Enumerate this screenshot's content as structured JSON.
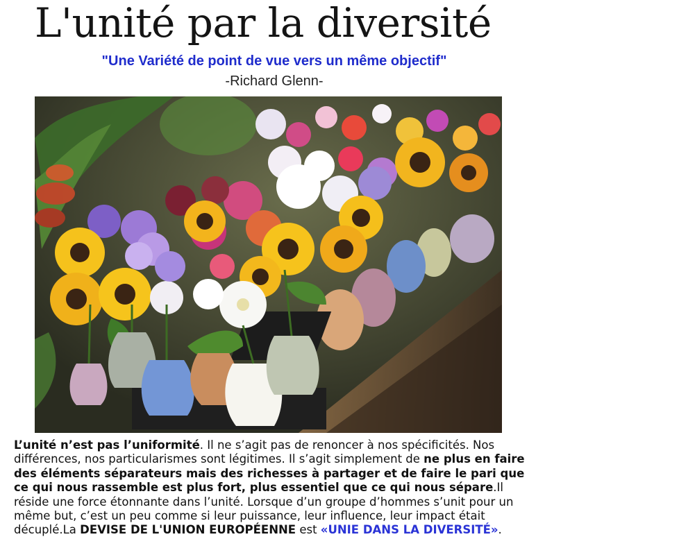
{
  "header": {
    "title": "L'unité par la diversité",
    "quote": "\"Une Variété de point de vue vers un même objectif\"",
    "author": "-Richard Glenn-"
  },
  "image": {
    "subject": "flower-bouquets-in-vases"
  },
  "article": {
    "s1_bold": "L’unité n’est pas l’uniformité",
    "s1_rest": ". Il ne s’agit pas de renoncer à nos spécificités. Nos différences, nos particularismes sont légitimes. Il s’agit simplement de ",
    "s2_bold": "ne plus en faire des éléments séparateurs mais des richesses à partager et de faire le pari que ce qui nous rassemble est plus fort, plus essentiel que ce qui nous sépare",
    "s2_rest": ".Il réside une force étonnante dans l’unité. Lorsque d’un groupe d’hommes s’unit pour un même but, c’est un peu comme si leur puissance, leur influence, leur impact était décuplé.La ",
    "s3_bold": "DEVISE DE L'UNION EUROPÉENNE",
    "s3_mid": " est ",
    "s3_link": "«UNIE DANS LA DIVERSITÉ»",
    "s3_end": "."
  },
  "colors": {
    "quote": "#1f2ccc",
    "link": "#2a33d6",
    "text": "#111111"
  }
}
